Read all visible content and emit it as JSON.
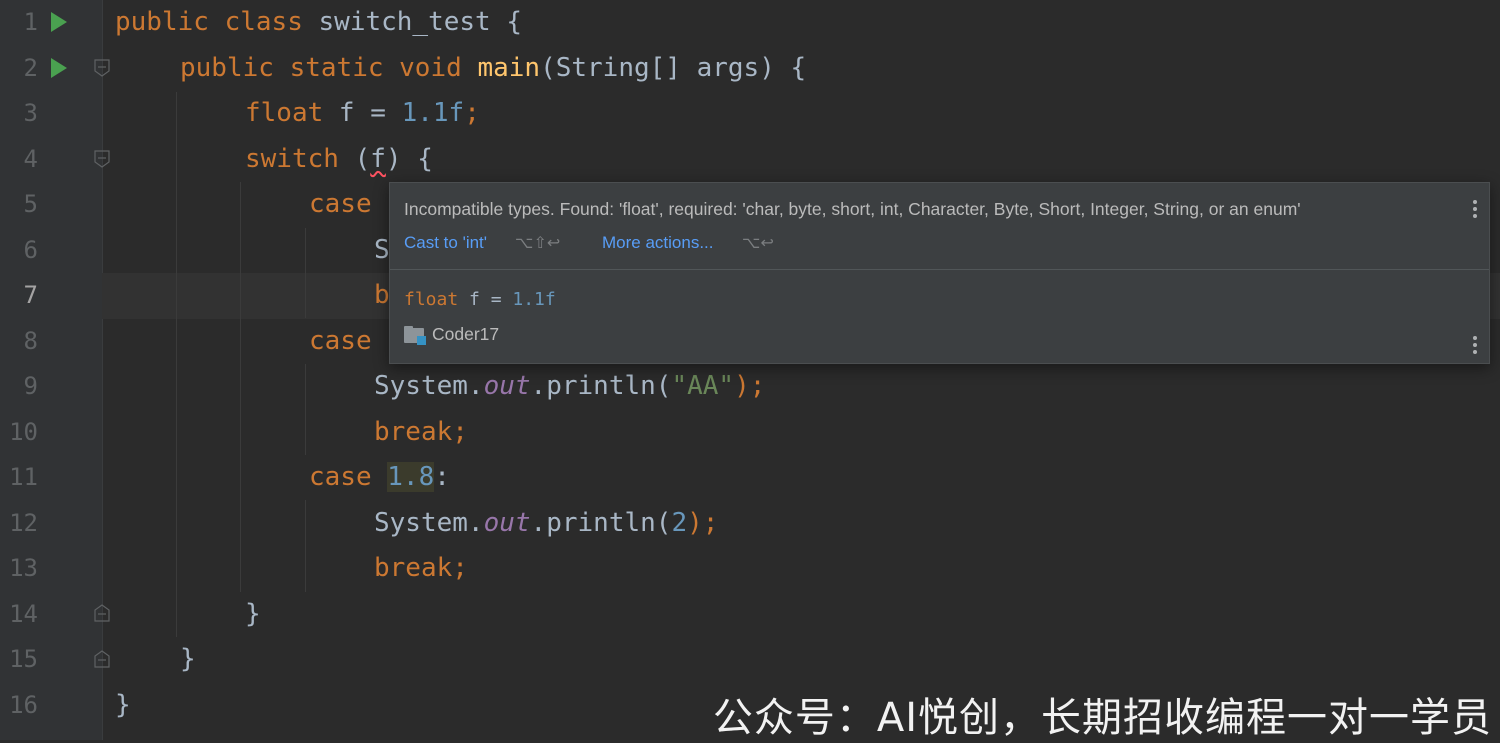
{
  "editor": {
    "line_numbers": [
      "1",
      "2",
      "3",
      "4",
      "5",
      "6",
      "7",
      "8",
      "9",
      "10",
      "11",
      "12",
      "13",
      "14",
      "15",
      "16"
    ],
    "current_line": "7",
    "code": {
      "l1": {
        "kw1": "public",
        "kw2": "class",
        "name": "switch_test",
        "brace": "{"
      },
      "l2": {
        "kw1": "public",
        "kw2": "static",
        "kw3": "void",
        "fn": "main",
        "params": "(String[] args) {"
      },
      "l3": {
        "kw": "float",
        "mid": " f = ",
        "num": "1.1f",
        "semi": ";"
      },
      "l4": {
        "kw": "switch",
        "open": " (",
        "var": "f",
        "close": ") {"
      },
      "l5": {
        "kw": "case"
      },
      "l6": {
        "text": "S"
      },
      "l7": {
        "text": "b"
      },
      "l8": {
        "kw": "case"
      },
      "l9": {
        "obj": "System.",
        "field": "out",
        "call": ".println(",
        "str": "\"AA\"",
        "end": ");"
      },
      "l10": {
        "kw": "break;"
      },
      "l11": {
        "kw": "case",
        "num": "1.8",
        "colon": ":"
      },
      "l12": {
        "obj": "System.",
        "field": "out",
        "call": ".println(",
        "num": "2",
        "end": ");"
      },
      "l13": {
        "kw": "break;"
      },
      "l14": {
        "brace": "}"
      },
      "l15": {
        "brace": "}"
      },
      "l16": {
        "brace": "}"
      }
    }
  },
  "popup": {
    "message": "Incompatible types. Found: 'float', required: 'char, byte, short, int, Character, Byte, Short, Integer, String, or an enum'",
    "action1": "Cast to 'int'",
    "action1_shortcut": "⌥⇧↩",
    "action2": "More actions...",
    "action2_shortcut": "⌥↩",
    "code_kw": "float",
    "code_mid": " f = ",
    "code_num": "1.1f",
    "module": "Coder17",
    "icons": [
      "more-vertical-icon",
      "module-folder-icon"
    ]
  },
  "watermark": "公众号：AI悦创，长期招收编程一对一学员",
  "colors": {
    "background": "#2b2b2b",
    "keyword": "#cc7832",
    "function": "#ffc66d",
    "number": "#6897bb",
    "string": "#6a8759",
    "field": "#9876aa",
    "link": "#589df6",
    "run_icon": "#4aa150"
  }
}
